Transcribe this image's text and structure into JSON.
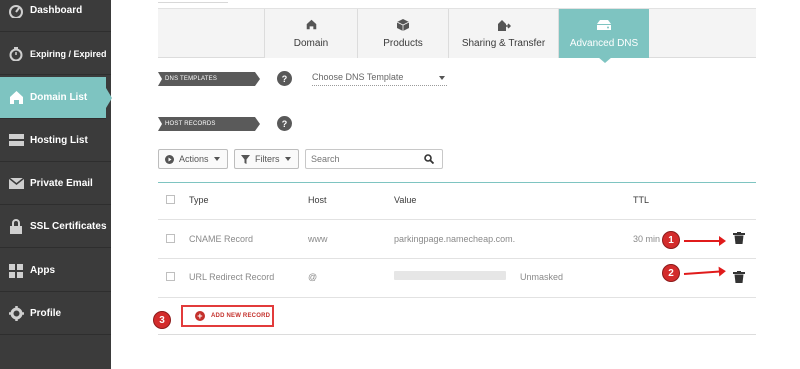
{
  "sidebar": {
    "items": [
      {
        "label": "Dashboard",
        "icon": "speedometer-icon"
      },
      {
        "label": "Expiring / Expired",
        "icon": "clock-icon"
      },
      {
        "label": "Domain List",
        "icon": "home-icon",
        "active": true
      },
      {
        "label": "Hosting List",
        "icon": "server-icon"
      },
      {
        "label": "Private Email",
        "icon": "envelope-icon"
      },
      {
        "label": "SSL Certificates",
        "icon": "lock-icon"
      },
      {
        "label": "Apps",
        "icon": "apps-icon"
      },
      {
        "label": "Profile",
        "icon": "gear-icon"
      }
    ]
  },
  "tabs": [
    {
      "label": "Domain",
      "icon": "home-icon"
    },
    {
      "label": "Products",
      "icon": "box-icon"
    },
    {
      "label": "Sharing & Transfer",
      "icon": "share-icon"
    },
    {
      "label": "Advanced DNS",
      "icon": "dns-icon",
      "active": true
    }
  ],
  "dns_templates": {
    "label": "DNS TEMPLATES",
    "help": "?",
    "select_value": "Choose DNS Template"
  },
  "host_records": {
    "label": "HOST RECORDS",
    "help": "?"
  },
  "toolbar": {
    "actions_label": "Actions",
    "filters_label": "Filters",
    "search_placeholder": "Search"
  },
  "table": {
    "headers": {
      "type": "Type",
      "host": "Host",
      "value": "Value",
      "ttl": "TTL"
    },
    "rows": [
      {
        "type": "CNAME Record",
        "host": "www",
        "value": "parkingpage.namecheap.com.",
        "ttl": "30 min"
      },
      {
        "type": "URL Redirect Record",
        "host": "@",
        "value": "",
        "ttl": "Unmasked"
      }
    ]
  },
  "add_record_label": "ADD NEW RECORD",
  "annotations": {
    "badge1": "1",
    "badge2": "2",
    "badge3": "3"
  },
  "colors": {
    "accent": "#7ec4c1",
    "sidebar": "#3b3b3b",
    "annotation": "#d32c2c"
  }
}
